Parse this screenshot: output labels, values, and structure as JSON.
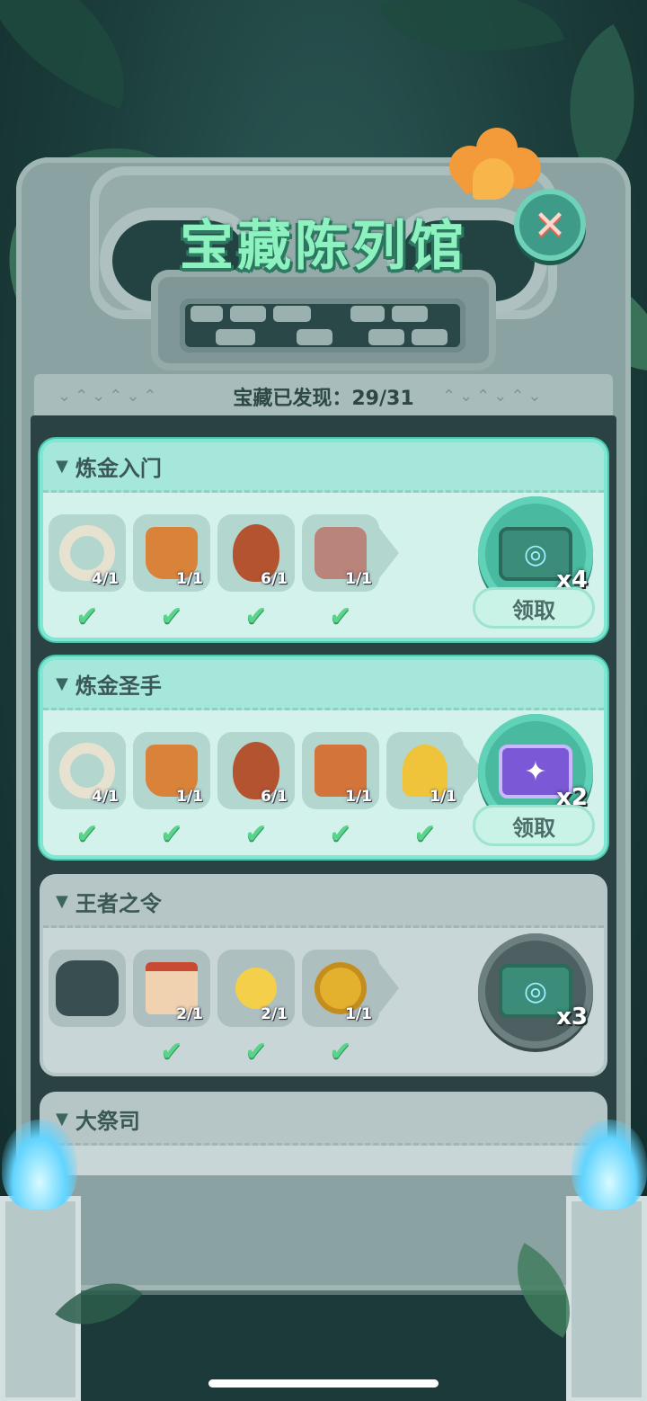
{
  "window": {
    "title": "宝藏陈列馆",
    "close_icon": "close-icon"
  },
  "progress": {
    "text": "宝藏已发现：29/31",
    "found": 29,
    "total": 31
  },
  "colors": {
    "accent": "#7fe8d4",
    "title_green": "#8ef2c0",
    "check_green": "#5bd38a",
    "close_button": "#3d9b87"
  },
  "collections": [
    {
      "name": "炼金入门",
      "state": "claimable",
      "items": [
        {
          "icon": "stone-ring-icon",
          "count": "4/1",
          "checked": true
        },
        {
          "icon": "tiki-mask-icon",
          "count": "1/1",
          "checked": true
        },
        {
          "icon": "tribal-shield-icon",
          "count": "6/1",
          "checked": true
        },
        {
          "icon": "stone-tablet-icon",
          "count": "1/1",
          "checked": true
        }
      ],
      "reward": {
        "icon": "eye-ticket-icon",
        "qty": "x4"
      },
      "claim_label": "领取"
    },
    {
      "name": "炼金圣手",
      "state": "claimable",
      "items": [
        {
          "icon": "stone-ring-icon",
          "count": "4/1",
          "checked": true
        },
        {
          "icon": "tiki-mask-icon",
          "count": "1/1",
          "checked": true
        },
        {
          "icon": "tribal-shield-icon",
          "count": "6/1",
          "checked": true
        },
        {
          "icon": "treasure-book-icon",
          "count": "1/1",
          "checked": true
        },
        {
          "icon": "golden-trophy-icon",
          "count": "1/1",
          "checked": true
        }
      ],
      "reward": {
        "icon": "purple-card-pack-icon",
        "qty": "x2"
      },
      "claim_label": "领取"
    },
    {
      "name": "王者之令",
      "state": "locked",
      "items": [
        {
          "icon": "paw-silhouette-icon",
          "count": "",
          "checked": false
        },
        {
          "icon": "royal-scroll-icon",
          "count": "2/1",
          "checked": true
        },
        {
          "icon": "mickey-scepter-icon",
          "count": "2/1",
          "checked": true
        },
        {
          "icon": "gold-medallion-icon",
          "count": "1/1",
          "checked": true
        }
      ],
      "reward": {
        "icon": "eye-ticket-icon",
        "qty": "x3"
      }
    },
    {
      "name": "大祭司",
      "state": "locked",
      "items": []
    }
  ],
  "check_glyph": "✔"
}
